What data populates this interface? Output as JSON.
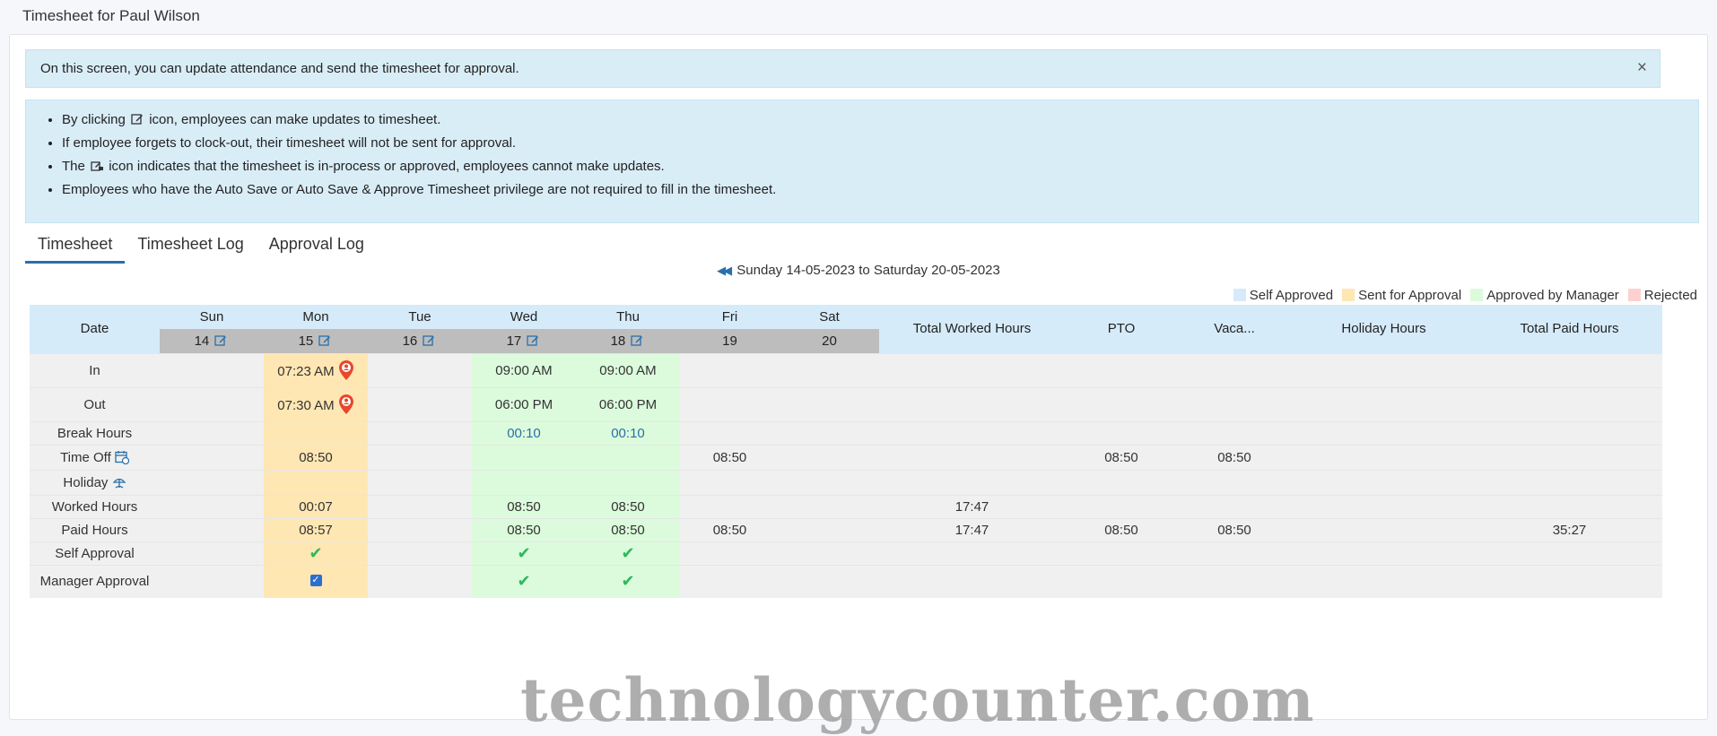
{
  "page": {
    "title": "Timesheet for Paul Wilson"
  },
  "alert": {
    "message": "On this screen, you can update attendance and send the timesheet for approval.",
    "close": "×"
  },
  "info": {
    "line1_pre": "By clicking",
    "line1_post": "icon, employees can make updates to timesheet.",
    "line2": "If employee forgets to clock-out, their timesheet will not be sent for approval.",
    "line3_pre": "The",
    "line3_post": "icon indicates that the timesheet is in-process or approved, employees cannot make updates.",
    "line4": "Employees who have the Auto Save or Auto Save & Approve Timesheet privilege are not required to fill in the timesheet."
  },
  "tabs": [
    "Timesheet",
    "Timesheet Log",
    "Approval Log"
  ],
  "week": {
    "label": "Sunday 14-05-2023 to Saturday 20-05-2023"
  },
  "legend": [
    {
      "label": "Self Approved",
      "color": "#d6ebfa"
    },
    {
      "label": "Sent for Approval",
      "color": "#ffe7b3"
    },
    {
      "label": "Approved by Manager",
      "color": "#dcfbdc"
    },
    {
      "label": "Rejected",
      "color": "#ffd0d0"
    }
  ],
  "table": {
    "date_header": "Date",
    "days": [
      {
        "name": "Sun",
        "num": "14"
      },
      {
        "name": "Mon",
        "num": "15"
      },
      {
        "name": "Tue",
        "num": "16"
      },
      {
        "name": "Wed",
        "num": "17"
      },
      {
        "name": "Thu",
        "num": "18"
      },
      {
        "name": "Fri",
        "num": "19"
      },
      {
        "name": "Sat",
        "num": "20"
      }
    ],
    "totals_headers": [
      "Total Worked Hours",
      "PTO",
      "Vaca...",
      "Holiday Hours",
      "Total Paid Hours"
    ],
    "rows": {
      "in": {
        "label": "In",
        "mon": "07:23 AM",
        "wed": "09:00 AM",
        "thu": "09:00 AM"
      },
      "out": {
        "label": "Out",
        "mon": "07:30 AM",
        "wed": "06:00 PM",
        "thu": "06:00 PM"
      },
      "break": {
        "label": "Break Hours",
        "wed": "00:10",
        "thu": "00:10"
      },
      "timeoff": {
        "label": "Time Off",
        "mon": "08:50",
        "fri": "08:50",
        "pto": "08:50",
        "vac": "08:50"
      },
      "holiday": {
        "label": "Holiday"
      },
      "worked": {
        "label": "Worked Hours",
        "mon": "00:07",
        "wed": "08:50",
        "thu": "08:50",
        "total": "17:47"
      },
      "paid": {
        "label": "Paid Hours",
        "mon": "08:57",
        "wed": "08:50",
        "thu": "08:50",
        "fri": "08:50",
        "total": "17:47",
        "pto": "08:50",
        "vac": "08:50",
        "totalpaid": "35:27"
      },
      "self": {
        "label": "Self Approval",
        "check": "✔"
      },
      "manager": {
        "label": "Manager Approval",
        "check": "✔",
        "box": "✓"
      }
    }
  },
  "watermark": "technologycounter.com",
  "icons": [
    "edit-icon",
    "locked-edit-icon",
    "location-pin-icon",
    "calendar-icon",
    "holiday-icon",
    "check-icon",
    "checkbox-icon",
    "rewind-icon",
    "close-icon"
  ]
}
